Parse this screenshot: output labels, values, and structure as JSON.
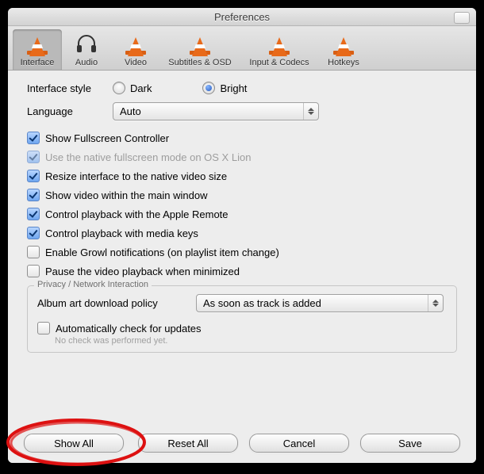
{
  "window": {
    "title": "Preferences"
  },
  "toolbar": {
    "items": [
      {
        "label": "Interface"
      },
      {
        "label": "Audio"
      },
      {
        "label": "Video"
      },
      {
        "label": "Subtitles & OSD"
      },
      {
        "label": "Input & Codecs"
      },
      {
        "label": "Hotkeys"
      }
    ]
  },
  "form": {
    "interface_style_label": "Interface style",
    "radio_dark": "Dark",
    "radio_bright": "Bright",
    "language_label": "Language",
    "language_value": "Auto"
  },
  "checks": [
    {
      "label": "Show Fullscreen Controller",
      "checked": true,
      "disabled": false
    },
    {
      "label": "Use the native fullscreen mode on OS X Lion",
      "checked": true,
      "disabled": true
    },
    {
      "label": "Resize interface to the native video size",
      "checked": true,
      "disabled": false
    },
    {
      "label": "Show video within the main window",
      "checked": true,
      "disabled": false
    },
    {
      "label": "Control playback with the Apple Remote",
      "checked": true,
      "disabled": false
    },
    {
      "label": "Control playback with media keys",
      "checked": true,
      "disabled": false
    },
    {
      "label": "Enable Growl notifications (on playlist item change)",
      "checked": false,
      "disabled": false
    },
    {
      "label": "Pause the video playback when minimized",
      "checked": false,
      "disabled": false
    }
  ],
  "group": {
    "title": "Privacy / Network Interaction",
    "album_art_label": "Album art download policy",
    "album_art_value": "As soon as track is added",
    "auto_update_label": "Automatically check for updates",
    "auto_update_checked": false,
    "last_check_text": "No check was performed yet."
  },
  "buttons": {
    "show_all": "Show All",
    "reset_all": "Reset All",
    "cancel": "Cancel",
    "save": "Save"
  }
}
